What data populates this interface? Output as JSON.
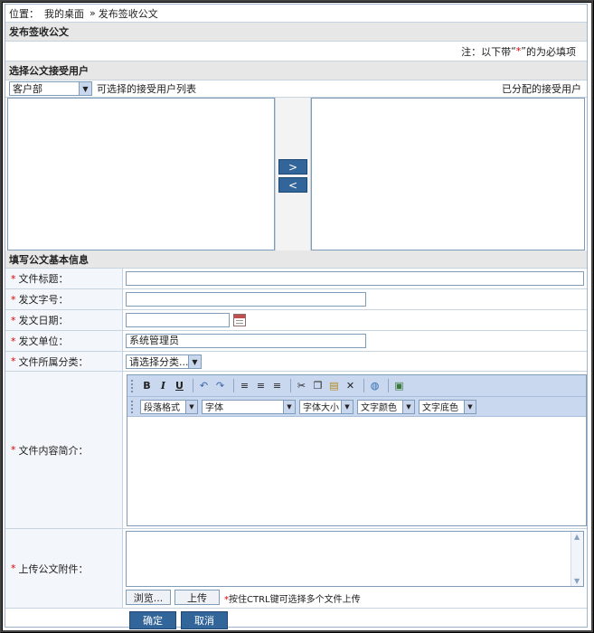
{
  "breadcrumb": {
    "prefix": "位置：",
    "home": "我的桌面",
    "sep": "»",
    "current": "发布签收公文"
  },
  "section_title": "发布签收公文",
  "note": {
    "before": "注：以下带",
    "quote_open": "“",
    "star": "*",
    "quote_close": "”",
    "after": "的为必填项"
  },
  "select_users": {
    "title": "选择公文接受用户",
    "department": "客户部",
    "available_label": "可选择的接受用户列表",
    "assigned_label": "已分配的接受用户",
    "add_label": ">",
    "remove_label": "<"
  },
  "basic_info": {
    "title": "填写公文基本信息",
    "required_mark": "*",
    "fields": {
      "doc_title": {
        "label": "文件标题：",
        "value": ""
      },
      "doc_number": {
        "label": "发文字号：",
        "value": ""
      },
      "issue_date": {
        "label": "发文日期：",
        "value": ""
      },
      "issuer": {
        "label": "发文单位：",
        "value": "系统管理员"
      },
      "category": {
        "label": "文件所属分类：",
        "value": "请选择分类..."
      },
      "content": {
        "label": "文件内容简介："
      },
      "attachment": {
        "label": "上传公文附件："
      }
    }
  },
  "editor": {
    "bold": "B",
    "italic": "I",
    "underline": "U",
    "paragraph_format": "段落格式",
    "font": "字体",
    "font_size": "字体大小",
    "text_color": "文字颜色",
    "bg_color": "文字底色"
  },
  "upload": {
    "browse": "浏览...",
    "upload": "上传",
    "hint_star": "*",
    "hint": "按住CTRL键可选择多个文件上传"
  },
  "actions": {
    "confirm": "确定",
    "cancel": "取消"
  }
}
